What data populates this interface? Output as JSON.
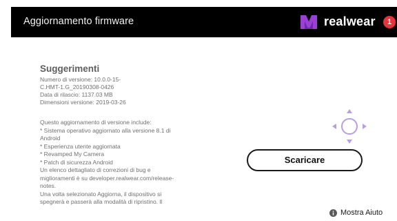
{
  "header": {
    "title": "Aggiornamento firmware",
    "brand": "realwear",
    "notification_count": "1",
    "colors": {
      "bar": "#000000",
      "badge": "#e8323c",
      "logo": "#9b3fd6"
    }
  },
  "info": {
    "section_title": "Suggerimenti",
    "meta_lines": [
      "Numero di versione: 10.0.0-15-",
      "C.HMT-1.G_20190308-0426",
      "Data di rilascio: 1137.03 MB",
      "Dimensioni versione: 2019-03-26"
    ]
  },
  "release_notes": [
    "Questo aggiornamento di versione include:",
    "* Sistema operativo aggiornato alla versione 8.1 di",
    "Android",
    "* Esperienza utente aggiornata",
    "* Revamped My Camera",
    "* Patch di sicurezza Android",
    "Un elenco dettagliato di correzioni di bug e",
    "miglioramenti è su developer.realwear.com/release-",
    "notes.",
    "Una volta selezionato Aggiorna, il dispositivo si",
    "spegnerà e passerà alla modalità di ripristino. Il"
  ],
  "actions": {
    "download_label": "Scaricare"
  },
  "help": {
    "label": "Mostra Aiuto"
  },
  "icons": {
    "dpad": "navigation-dpad-icon",
    "help": "info-icon",
    "logo": "realwear-logo-icon"
  },
  "colors": {
    "dpad": "#b79ee0",
    "text": "#707070"
  }
}
